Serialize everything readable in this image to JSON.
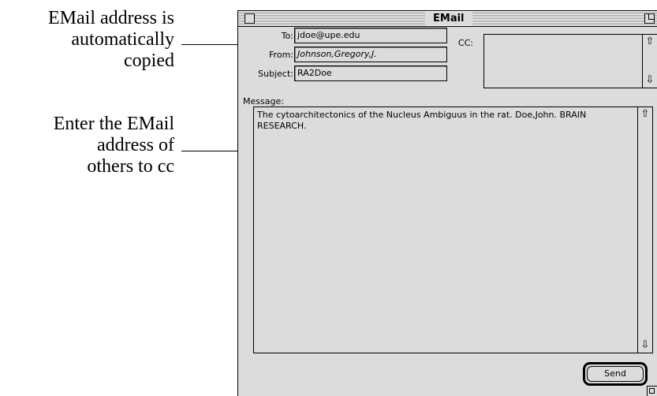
{
  "annotations": {
    "auto_copy": "EMail address is automatically copied",
    "cc_hint": "Enter the EMail address of others to cc"
  },
  "window": {
    "title": "EMail"
  },
  "form": {
    "to_label": "To:",
    "to_value": "jdoe@upe.edu",
    "from_label": "From:",
    "from_value": "Johnson,Gregory,J.",
    "subject_label": "Subject:",
    "subject_value": "RA2Doe",
    "cc_label": "CC:",
    "cc_value": "",
    "message_label": "Message:",
    "message_text": "The cytoarchitectonics of the Nucleus Ambiguus in the rat. Doe,John. BRAIN RESEARCH."
  },
  "buttons": {
    "send": "Send"
  },
  "icons": [
    "close-box-icon",
    "zoom-box-icon",
    "arrow-up-icon",
    "arrow-down-icon",
    "grow-box-icon"
  ]
}
